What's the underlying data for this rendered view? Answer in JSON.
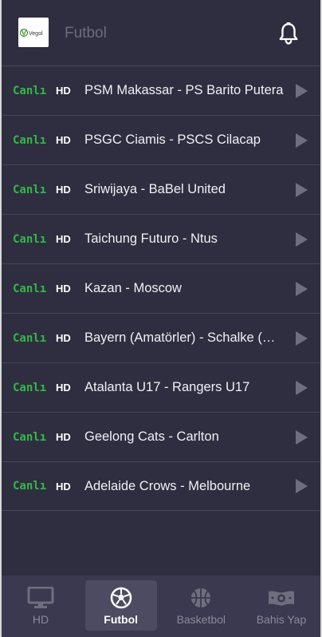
{
  "header": {
    "logo_text": "Vegol",
    "title": "Futbol"
  },
  "colors": {
    "background": "#2f2e40",
    "live_green": "#30b944",
    "tabbar": "#3a394f",
    "tab_active": "#4c4b61"
  },
  "matches": [
    {
      "live": "Canlı",
      "quality": "HD",
      "title": "PSM Makassar - PS Barito Putera"
    },
    {
      "live": "Canlı",
      "quality": "HD",
      "title": "PSGC Ciamis - PSCS Cilacap"
    },
    {
      "live": "Canlı",
      "quality": "HD",
      "title": "Sriwijaya - BaBel United"
    },
    {
      "live": "Canlı",
      "quality": "HD",
      "title": "Taichung Futuro - Ntus"
    },
    {
      "live": "Canlı",
      "quality": "HD",
      "title": "Kazan - Moscow"
    },
    {
      "live": "Canlı",
      "quality": "HD",
      "title": "Bayern (Amatörler) - Schalke (Amatörler)"
    },
    {
      "live": "Canlı",
      "quality": "HD",
      "title": "Atalanta U17 - Rangers U17"
    },
    {
      "live": "Canlı",
      "quality": "HD",
      "title": "Geelong Cats - Carlton"
    },
    {
      "live": "Canlı",
      "quality": "HD",
      "title": "Adelaide Crows - Melbourne"
    }
  ],
  "tabs": [
    {
      "label": "HD",
      "icon": "monitor-icon",
      "active": false
    },
    {
      "label": "Futbol",
      "icon": "soccer-ball-icon",
      "active": true
    },
    {
      "label": "Basketbol",
      "icon": "basketball-icon",
      "active": false
    },
    {
      "label": "Bahis Yap",
      "icon": "money-icon",
      "active": false
    }
  ]
}
